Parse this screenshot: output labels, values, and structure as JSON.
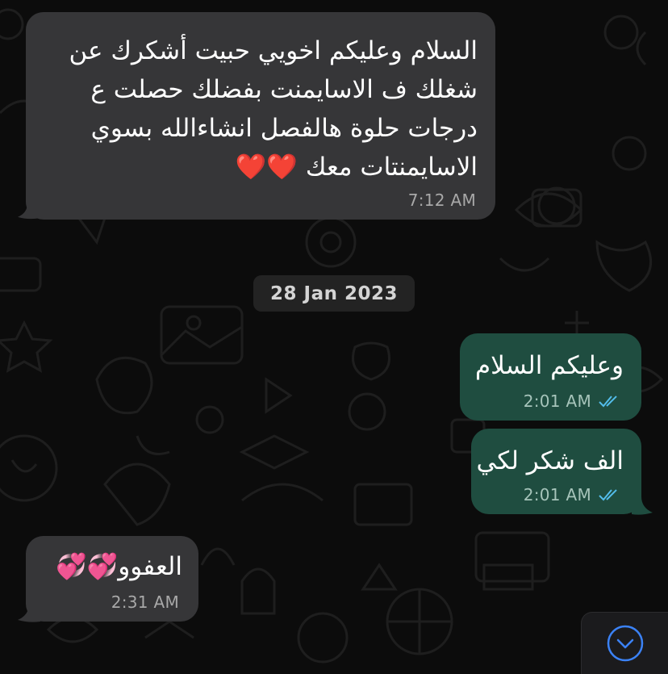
{
  "chat": {
    "messages": [
      {
        "direction": "incoming",
        "lines": [
          "السلام وعليكم اخويي حبيت أشكرك عن",
          "شغلك ف الاسايمنت بفضلك حصلت ع",
          "درجات حلوة هالفصل انشاءالله بسوي",
          "الاسايمنتات معك ❤️❤️"
        ],
        "time": "7:12 AM"
      },
      {
        "direction": "outgoing",
        "text": "وعليكم السلام",
        "time": "2:01 AM",
        "status": "read"
      },
      {
        "direction": "outgoing",
        "text": "الف شكر لكي",
        "time": "2:01 AM",
        "status": "read"
      },
      {
        "direction": "incoming",
        "text": "العفوو💞💞",
        "time": "2:31 AM"
      }
    ],
    "date_separator": "28 Jan 2023",
    "scroll_down_icon": "chevron-down-circle-icon"
  },
  "colors": {
    "incoming_bubble": "#363638",
    "outgoing_bubble": "#1f4d40",
    "read_ticks": "#53bdeb",
    "background": "#0c0c0c"
  }
}
